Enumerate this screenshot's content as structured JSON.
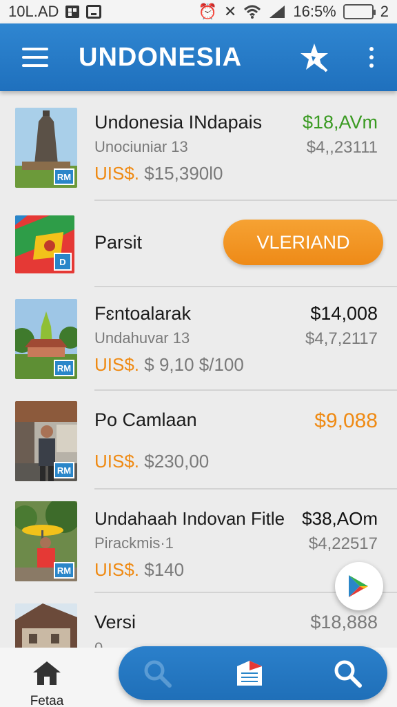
{
  "status_bar": {
    "left_text": "10L.AD",
    "time": "16:5%",
    "battery_level": "2",
    "battery_color": "#f5a31a"
  },
  "app_bar": {
    "title": "UNDONESIA",
    "color": "#2479c4"
  },
  "listings": [
    {
      "name": "Undonesia INdapais",
      "sub": "Unociuniar 13",
      "usd_tag": "UIS$.",
      "usd_value": "$15,390l0",
      "price": "$18,AVm",
      "price_color": "#3a9a22",
      "price2": "$4,,23111",
      "badge": "RM"
    },
    {
      "name": "Parsit",
      "button": "VLERIAND",
      "badge": "D"
    },
    {
      "name": "Fɛntoalarak",
      "sub": "Undahuvar 13",
      "usd_tag": "UIS$.",
      "usd_value": "$ 9,10 $/100",
      "price": "$14,008",
      "price_color": "#111111",
      "price2": "$4,7,2117",
      "badge": "RM"
    },
    {
      "name": "Po Camlaan",
      "usd_tag": "UIS$.",
      "usd_value": "$230,00",
      "price": "$9,088",
      "price_color": "#ef8a13",
      "badge": "RM"
    },
    {
      "name": "Undahaah Indovan Fitle",
      "sub": "Pirackmis·1",
      "usd_tag": "UIS$.",
      "usd_value": "$140",
      "price": "$38,AOm",
      "price_color": "#111111",
      "price2": "$4,22517",
      "badge": "RM"
    },
    {
      "name": "Versi",
      "sub": "0",
      "price": "$18,888",
      "price_color": "#7a7a7a"
    }
  ],
  "bottom_nav": {
    "home_label": "Fetaa"
  },
  "icons": {
    "menu": "hamburger-icon",
    "star": "star-wand-icon",
    "more": "more-vert-icon",
    "play": "play-store-icon",
    "home": "home-icon",
    "search": "search-icon",
    "news": "news-icon"
  }
}
